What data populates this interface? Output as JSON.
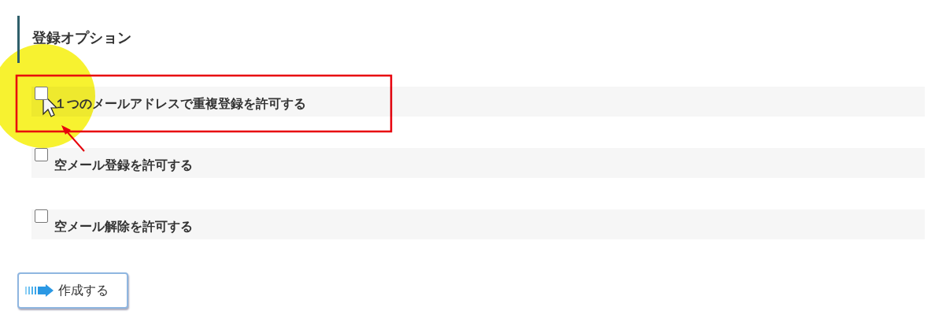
{
  "section": {
    "title": "登録オプション"
  },
  "options": [
    {
      "label": "１つのメールアドレスで重複登録を許可する",
      "checked": false
    },
    {
      "label": "空メール登録を許可する",
      "checked": false
    },
    {
      "label": "空メール解除を許可する",
      "checked": false
    }
  ],
  "buttons": [
    {
      "label": "作成する"
    }
  ]
}
